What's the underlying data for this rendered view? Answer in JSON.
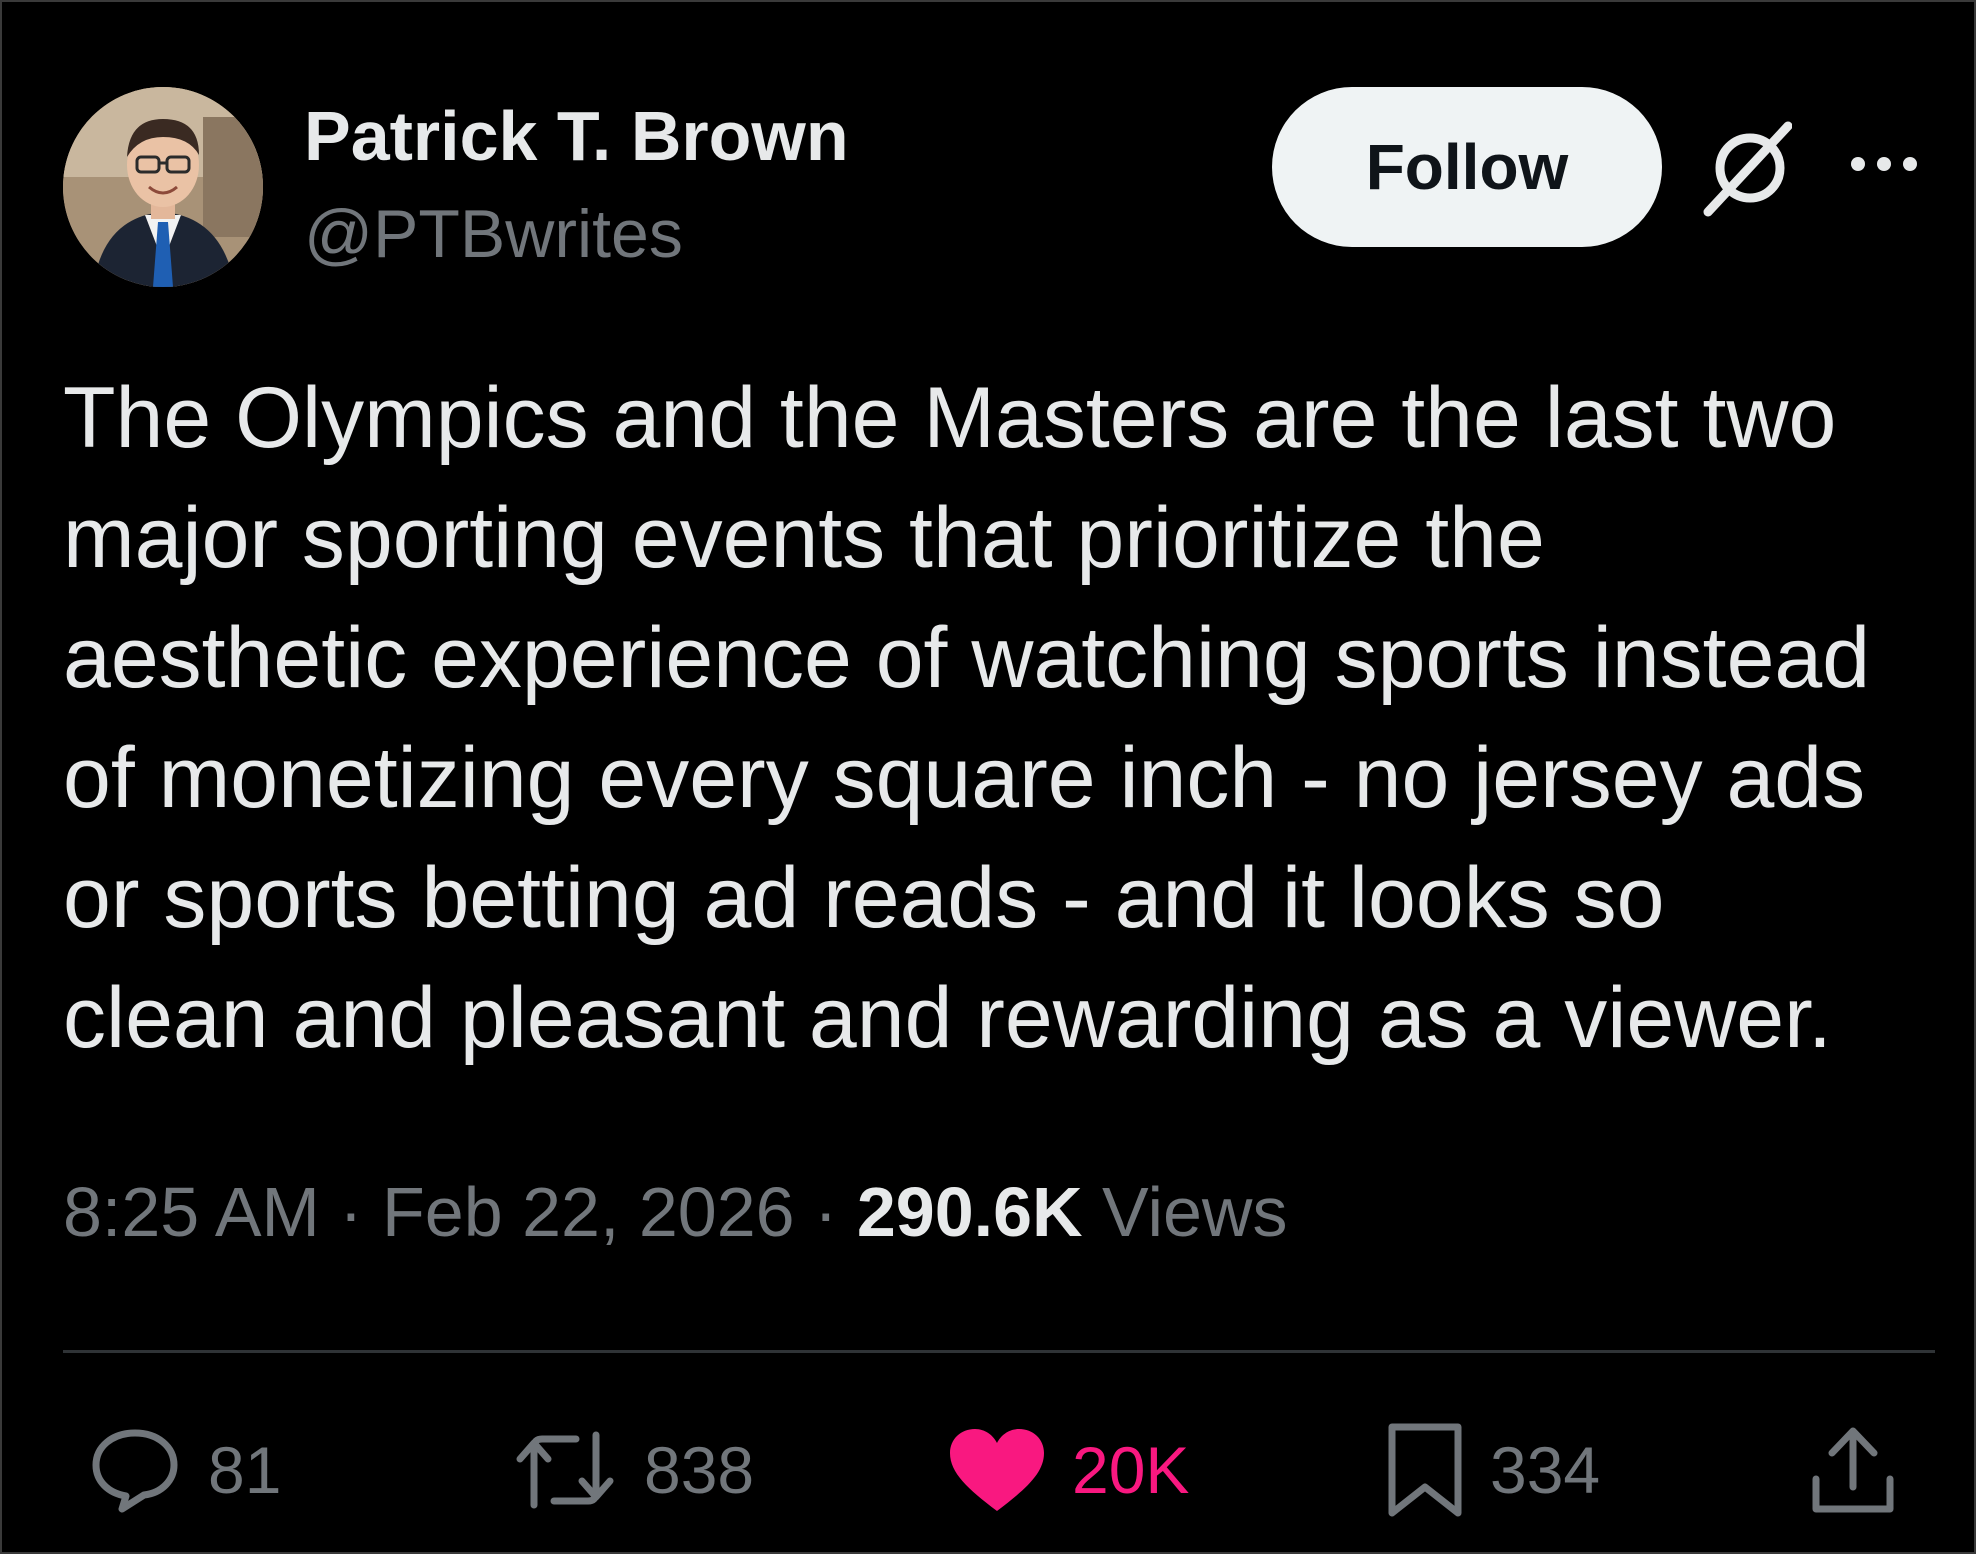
{
  "author": {
    "display_name": "Patrick T. Brown",
    "handle": "@PTBwrites"
  },
  "header": {
    "follow_label": "Follow",
    "icons": [
      "grok-icon",
      "more-icon"
    ]
  },
  "tweet": {
    "text_lines": [
      "The Olympics and the Masters are the last two",
      "major sporting events that prioritize the",
      "aesthetic experience of watching sports instead",
      "of monetizing every square inch - no jersey ads",
      "or sports betting ad reads - and it looks so",
      "clean and pleasant and rewarding as a viewer."
    ],
    "time": "8:25 AM",
    "date": "Feb 22, 2026",
    "views_count": "290.6K",
    "views_label": "Views",
    "separator": "·"
  },
  "actions": {
    "reply_count": "81",
    "repost_count": "838",
    "like_count": "20K",
    "bookmark_count": "334"
  },
  "colors": {
    "background": "#000000",
    "text_primary": "#e7e9ea",
    "text_secondary": "#71767b",
    "like_pink": "#f91880",
    "follow_bg": "#eff3f4"
  }
}
